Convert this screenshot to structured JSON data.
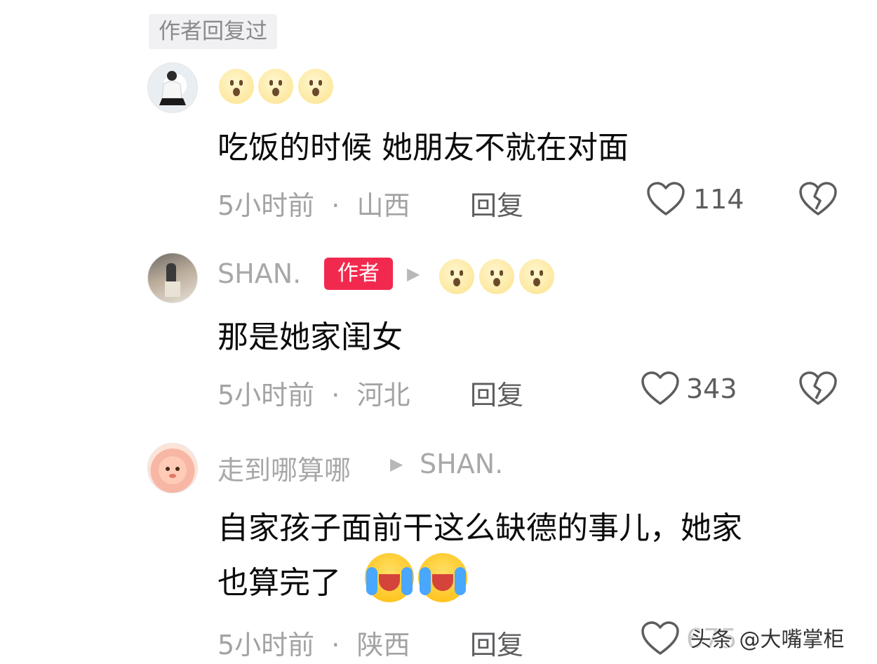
{
  "header": {
    "tag": "作者回复过"
  },
  "comments": [
    {
      "username": "",
      "content_lines": [
        "吃饭的时候 她朋友不就在对面"
      ],
      "time": "5小时前",
      "location": "山西",
      "reply_label": "回复",
      "likes": "114"
    },
    {
      "username": "SHAN.",
      "badge": "作者",
      "content_lines": [
        "那是她家闺女"
      ],
      "time": "5小时前",
      "location": "河北",
      "reply_label": "回复",
      "likes": "343"
    },
    {
      "username": "走到哪算哪",
      "reply_to": "SHAN.",
      "content_lines": [
        "自家孩子面前干这么缺德的事儿，她家",
        "也算完了"
      ],
      "time": "5小时前",
      "location": "陕西",
      "reply_label": "回复",
      "likes": "675"
    }
  ],
  "separator": "·",
  "watermark": "头条 @大嘴掌柜",
  "icons": [
    "heart-outline-icon",
    "broken-heart-icon",
    "triangle-right-icon",
    "astonished-emoji",
    "crying-laughing-emoji"
  ]
}
